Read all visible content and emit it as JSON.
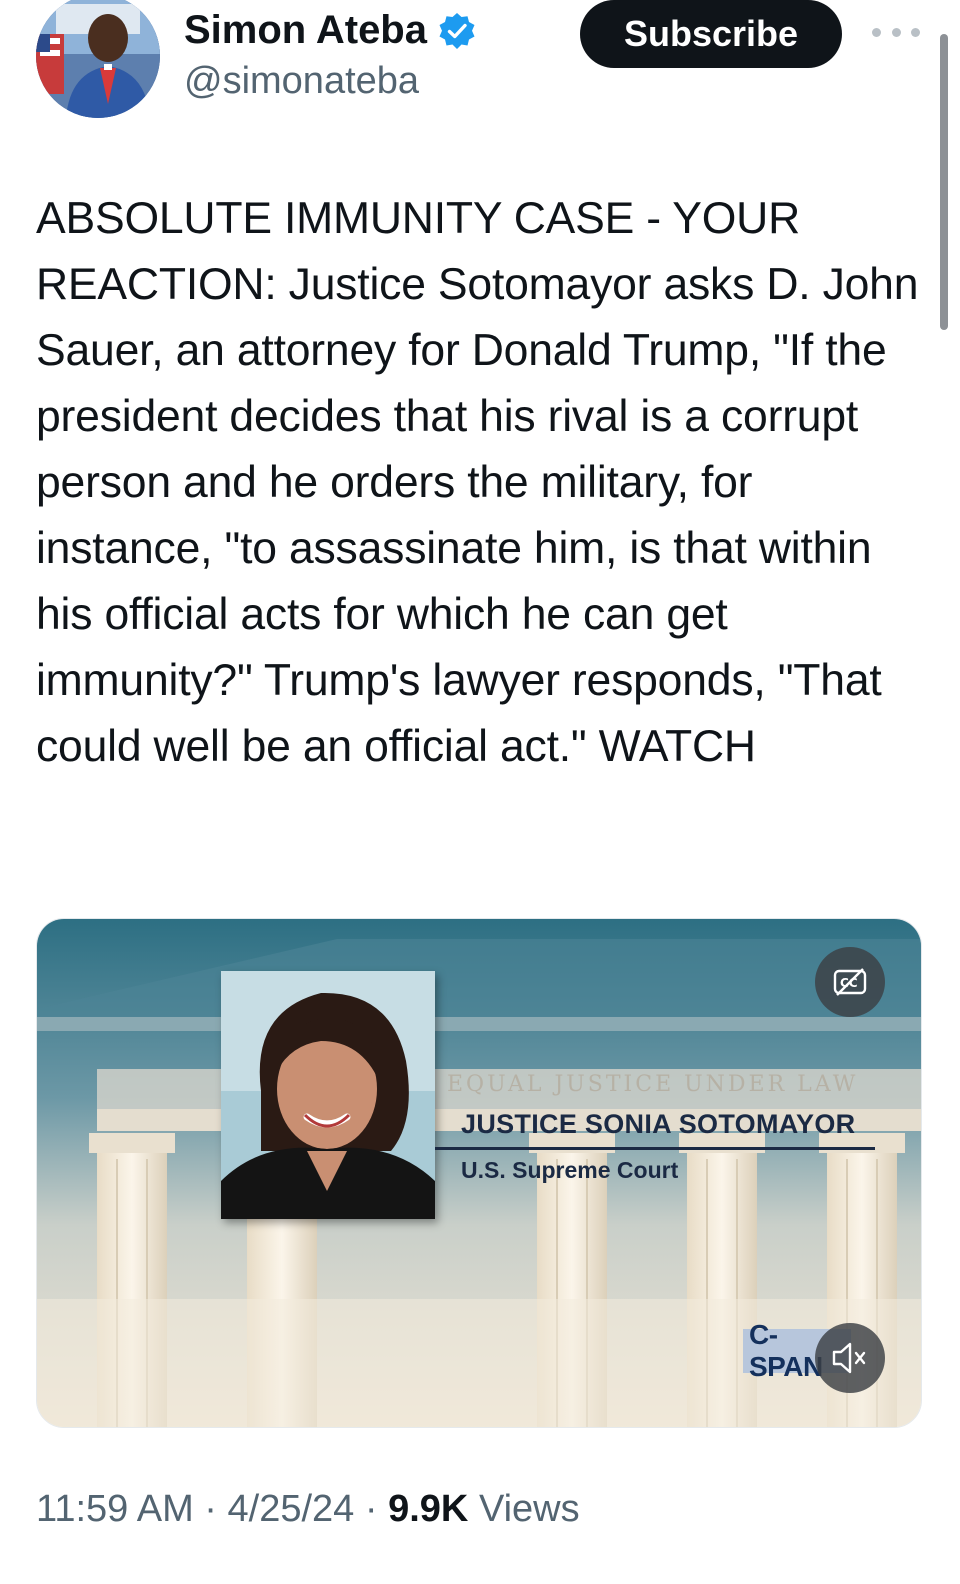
{
  "author": {
    "name": "Simon Ateba",
    "handle": "@simonateba",
    "verified": true
  },
  "header": {
    "subscribe_label": "Subscribe",
    "more_icon": "more-horizontal-icon"
  },
  "tweet": {
    "text": "ABSOLUTE IMMUNITY CASE - YOUR REACTION: Justice Sotomayor asks D. John Sauer, an attorney for Donald Trump, \"If the president decides that his rival is a corrupt person and he orders the military, for instance, \"to assassinate him, is that within his official acts for which he can get immunity?\" Trump's lawyer responds, \"That could well be an official act.\" WATCH"
  },
  "media": {
    "banner_name": "JUSTICE SONIA SOTOMAYOR",
    "banner_subtitle": "U.S. Supreme Court",
    "building_inscription": "EQUAL JUSTICE UNDER LAW",
    "network_logo": "C-SPAN",
    "captions_icon": "closed-captions-off-icon",
    "mute_icon": "speaker-muted-icon"
  },
  "meta": {
    "time": "11:59 AM",
    "separator": "·",
    "date": "4/25/24",
    "views_count": "9.9K",
    "views_label": "Views"
  },
  "colors": {
    "text_primary": "#0f1419",
    "text_secondary": "#536471",
    "verified_blue": "#1d9bf0",
    "subscribe_bg": "#0f1419"
  }
}
